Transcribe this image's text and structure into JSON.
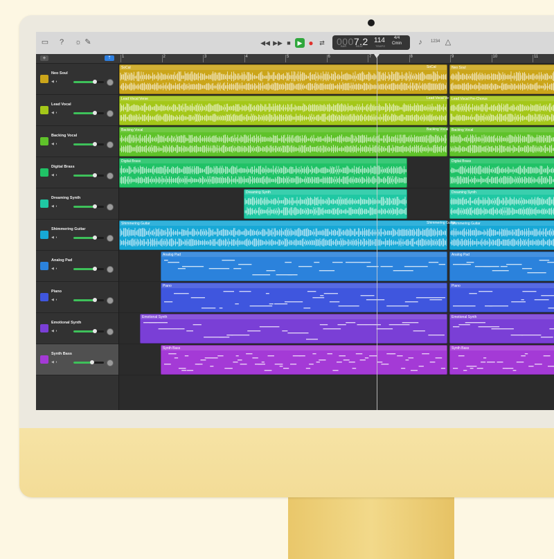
{
  "transport": {
    "position_dim": "000",
    "position": "7.2",
    "bar_label": "BAR",
    "beat_label": "BEAT",
    "tempo": "114",
    "tempo_label": "TEMPO",
    "signature": "4/4",
    "key": "Cmin",
    "count_in": "1234"
  },
  "icons": {
    "library": "library-icon",
    "quick_help": "help-icon",
    "smart_controls": "brightness-icon",
    "editors": "scissors-icon",
    "rewind": "rewind-icon",
    "forward": "forward-icon",
    "stop": "stop-icon",
    "play": "play-icon",
    "record": "record-icon",
    "cycle": "cycle-icon",
    "tuner": "tuner-icon",
    "metronome": "metronome-icon"
  },
  "header": {
    "add_label": "+",
    "filter_label": "⇡"
  },
  "ruler": [
    "1",
    "2",
    "3",
    "4",
    "5",
    "6",
    "7",
    "8",
    "9",
    "10",
    "11"
  ],
  "colors": {
    "Neo Soul": "#cba51a",
    "Lead Vocal": "#a4c719",
    "Backing Vocal": "#5fc22a",
    "Digital Brass": "#20c266",
    "Dreaming Synth": "#1fc8a3",
    "Shimmering Guitar": "#17a8d6",
    "Analog Pad": "#2b82dc",
    "Piano": "#3f56de",
    "Emotional Synth": "#7a3fd6",
    "Synth Bass": "#a43ad6"
  },
  "tracks": [
    {
      "name": "Neo Soul",
      "icon": "drum-kit-icon",
      "volume": 0.7,
      "regions": [
        {
          "name": "SoCal",
          "start": 0,
          "end": 474
        },
        {
          "name": "SoCal",
          "start": 442,
          "end": 474,
          "label_only": true
        },
        {
          "name": "Neo Soul",
          "start": 477,
          "end": 656
        }
      ]
    },
    {
      "name": "Lead Vocal",
      "icon": "microphone-icon",
      "volume": 0.7,
      "regions": [
        {
          "name": "Lead Vocal Verse",
          "start": 0,
          "end": 474
        },
        {
          "name": "Lead Vocal Ve",
          "start": 442,
          "end": 474,
          "label_only": true
        },
        {
          "name": "Lead Vocal Pre-Chorus",
          "start": 477,
          "end": 656
        }
      ]
    },
    {
      "name": "Backing Vocal",
      "icon": "keyboard-stand-icon",
      "volume": 0.7,
      "regions": [
        {
          "name": "Backing Vocal",
          "start": 0,
          "end": 474
        },
        {
          "name": "Backing Vocal",
          "start": 442,
          "end": 474,
          "label_only": true
        },
        {
          "name": "Backing Vocal",
          "start": 477,
          "end": 656
        }
      ]
    },
    {
      "name": "Digital Brass",
      "icon": "keyboard-stand-icon",
      "volume": 0.7,
      "regions": [
        {
          "name": "Digital Brass",
          "start": 0,
          "end": 416
        },
        {
          "name": "Digital Brass",
          "start": 477,
          "end": 656
        }
      ]
    },
    {
      "name": "Dreaming Synth",
      "icon": "synth-icon",
      "volume": 0.7,
      "regions": [
        {
          "name": "Dreaming Synth",
          "start": 180,
          "end": 416
        },
        {
          "name": "Dreaming Synth",
          "start": 477,
          "end": 656
        }
      ]
    },
    {
      "name": "Shimmering Guitar",
      "icon": "guitar-icon",
      "volume": 0.7,
      "regions": [
        {
          "name": "Shimmering Guitar",
          "start": 0,
          "end": 474
        },
        {
          "name": "Shimmering Guitar",
          "start": 442,
          "end": 474,
          "label_only": true
        },
        {
          "name": "Shimmering Guitar",
          "start": 477,
          "end": 656
        }
      ]
    },
    {
      "name": "Analog Pad",
      "icon": "synth-icon",
      "volume": 0.7,
      "regions": [
        {
          "name": "Analog Pad",
          "start": 60,
          "end": 474
        },
        {
          "name": "Analog Pad",
          "start": 477,
          "end": 656
        }
      ]
    },
    {
      "name": "Piano",
      "icon": "piano-icon",
      "volume": 0.7,
      "regions": [
        {
          "name": "Piano",
          "start": 60,
          "end": 474
        },
        {
          "name": "Piano",
          "start": 477,
          "end": 656
        }
      ]
    },
    {
      "name": "Emotional Synth",
      "icon": "synth-icon",
      "volume": 0.7,
      "regions": [
        {
          "name": "Emotional Synth",
          "start": 30,
          "end": 474
        },
        {
          "name": "Emotional Synth",
          "start": 477,
          "end": 656
        }
      ]
    },
    {
      "name": "Synth Bass",
      "icon": "synth-icon",
      "volume": 0.62,
      "selected": true,
      "regions": [
        {
          "name": "Synth Bass",
          "start": 60,
          "end": 474
        },
        {
          "name": "Synth Bass",
          "start": 477,
          "end": 656
        }
      ]
    }
  ]
}
